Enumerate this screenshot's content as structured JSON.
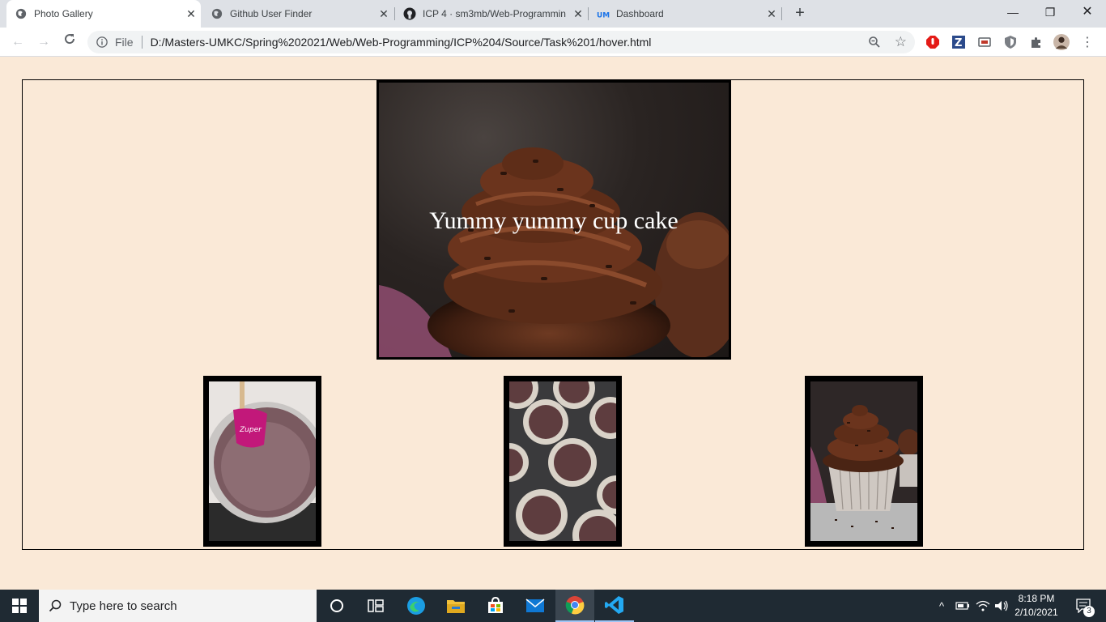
{
  "browser": {
    "tabs": [
      {
        "title": "Photo Gallery",
        "active": true
      },
      {
        "title": "Github User Finder",
        "active": false
      },
      {
        "title": "ICP 4 · sm3mb/Web-Programmin",
        "active": false
      },
      {
        "title": "Dashboard",
        "active": false
      }
    ],
    "new_tab_label": "+",
    "address": {
      "scheme_label": "File",
      "url": "D:/Masters-UMKC/Spring%202021/Web/Web-Programming/ICP%204/Source/Task%201/hover.html"
    }
  },
  "page": {
    "background": "#fae9d7",
    "hero_caption": "Yummy yummy cup cake"
  },
  "taskbar": {
    "search_placeholder": "Type here to search",
    "time": "8:18 PM",
    "date": "2/10/2021",
    "notification_count": "3"
  }
}
